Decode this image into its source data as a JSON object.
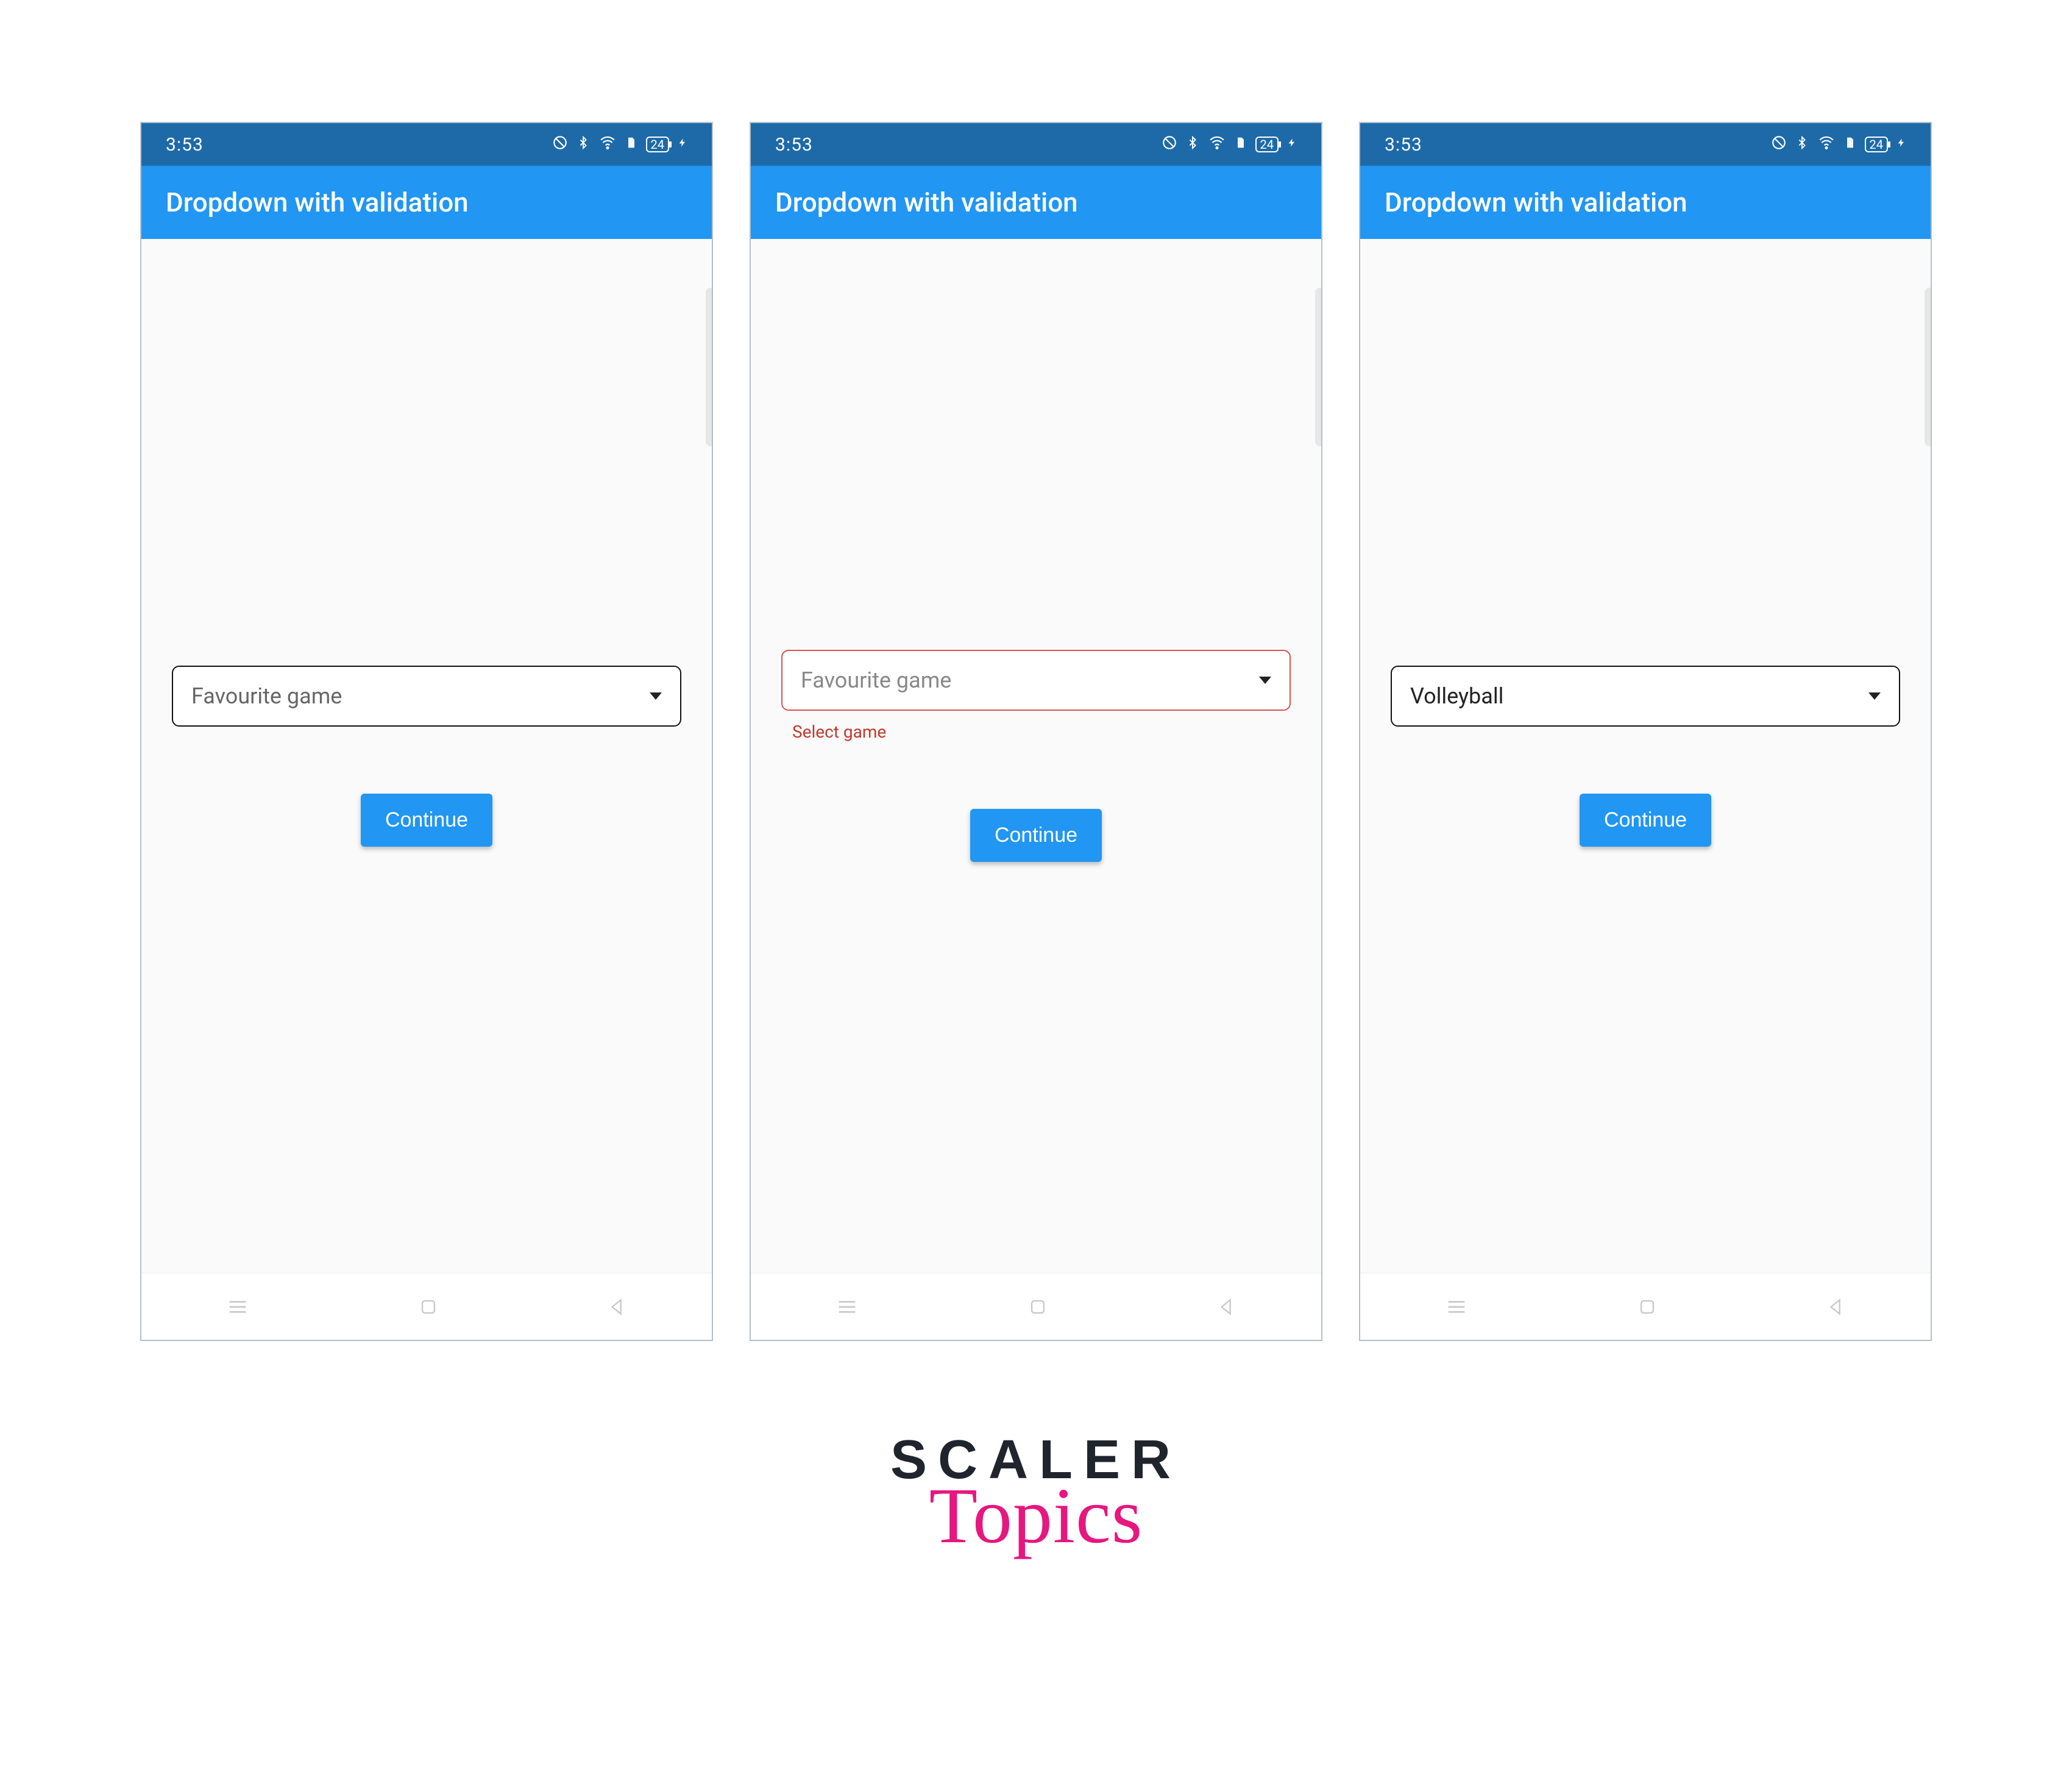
{
  "status": {
    "time": "3:53",
    "battery_level": "24"
  },
  "appbar": {
    "title": "Dropdown with validation"
  },
  "screens": [
    {
      "dropdown_value": "Favourite game",
      "dropdown_state": "normal",
      "error_text": null,
      "button_label": "Continue"
    },
    {
      "dropdown_value": "Favourite game",
      "dropdown_state": "error",
      "error_text": "Select game",
      "button_label": "Continue"
    },
    {
      "dropdown_value": "Volleyball",
      "dropdown_state": "selected",
      "error_text": null,
      "button_label": "Continue"
    }
  ],
  "branding": {
    "line1": "SCALER",
    "line2": "Topics"
  },
  "icons": {
    "dnd": "dnd-icon",
    "bluetooth": "bluetooth-icon",
    "wifi": "wifi-icon",
    "sim": "sim-icon",
    "bolt": "bolt-icon"
  }
}
